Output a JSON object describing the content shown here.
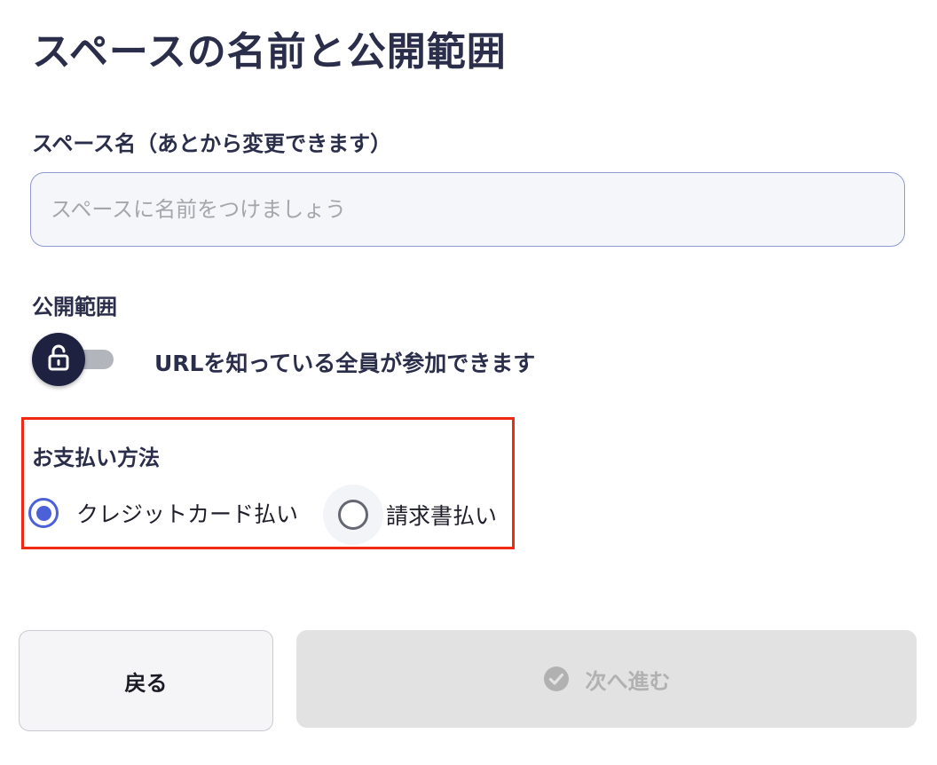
{
  "page": {
    "title": "スペースの名前と公開範囲"
  },
  "space_name": {
    "label": "スペース名（あとから変更できます）",
    "placeholder": "スペースに名前をつけましょう",
    "value": ""
  },
  "visibility": {
    "label": "公開範囲",
    "toggle_icon": "unlocked-padlock-icon",
    "toggle_state": "public",
    "description": "URLを知っている全員が参加できます"
  },
  "payment": {
    "label": "お支払い方法",
    "highlight_color": "#ee2a13",
    "options": [
      {
        "label": "クレジットカード払い",
        "selected": true
      },
      {
        "label": "請求書払い",
        "selected": false
      }
    ]
  },
  "actions": {
    "back_label": "戻る",
    "next_label": "次へ進む",
    "next_icon": "check-circle-icon",
    "next_disabled": true
  },
  "colors": {
    "accent": "#4c60d8",
    "title_text": "#2b2e4a",
    "toggle_knob": "#1e2240",
    "disabled_bg": "#e2e2e2"
  }
}
